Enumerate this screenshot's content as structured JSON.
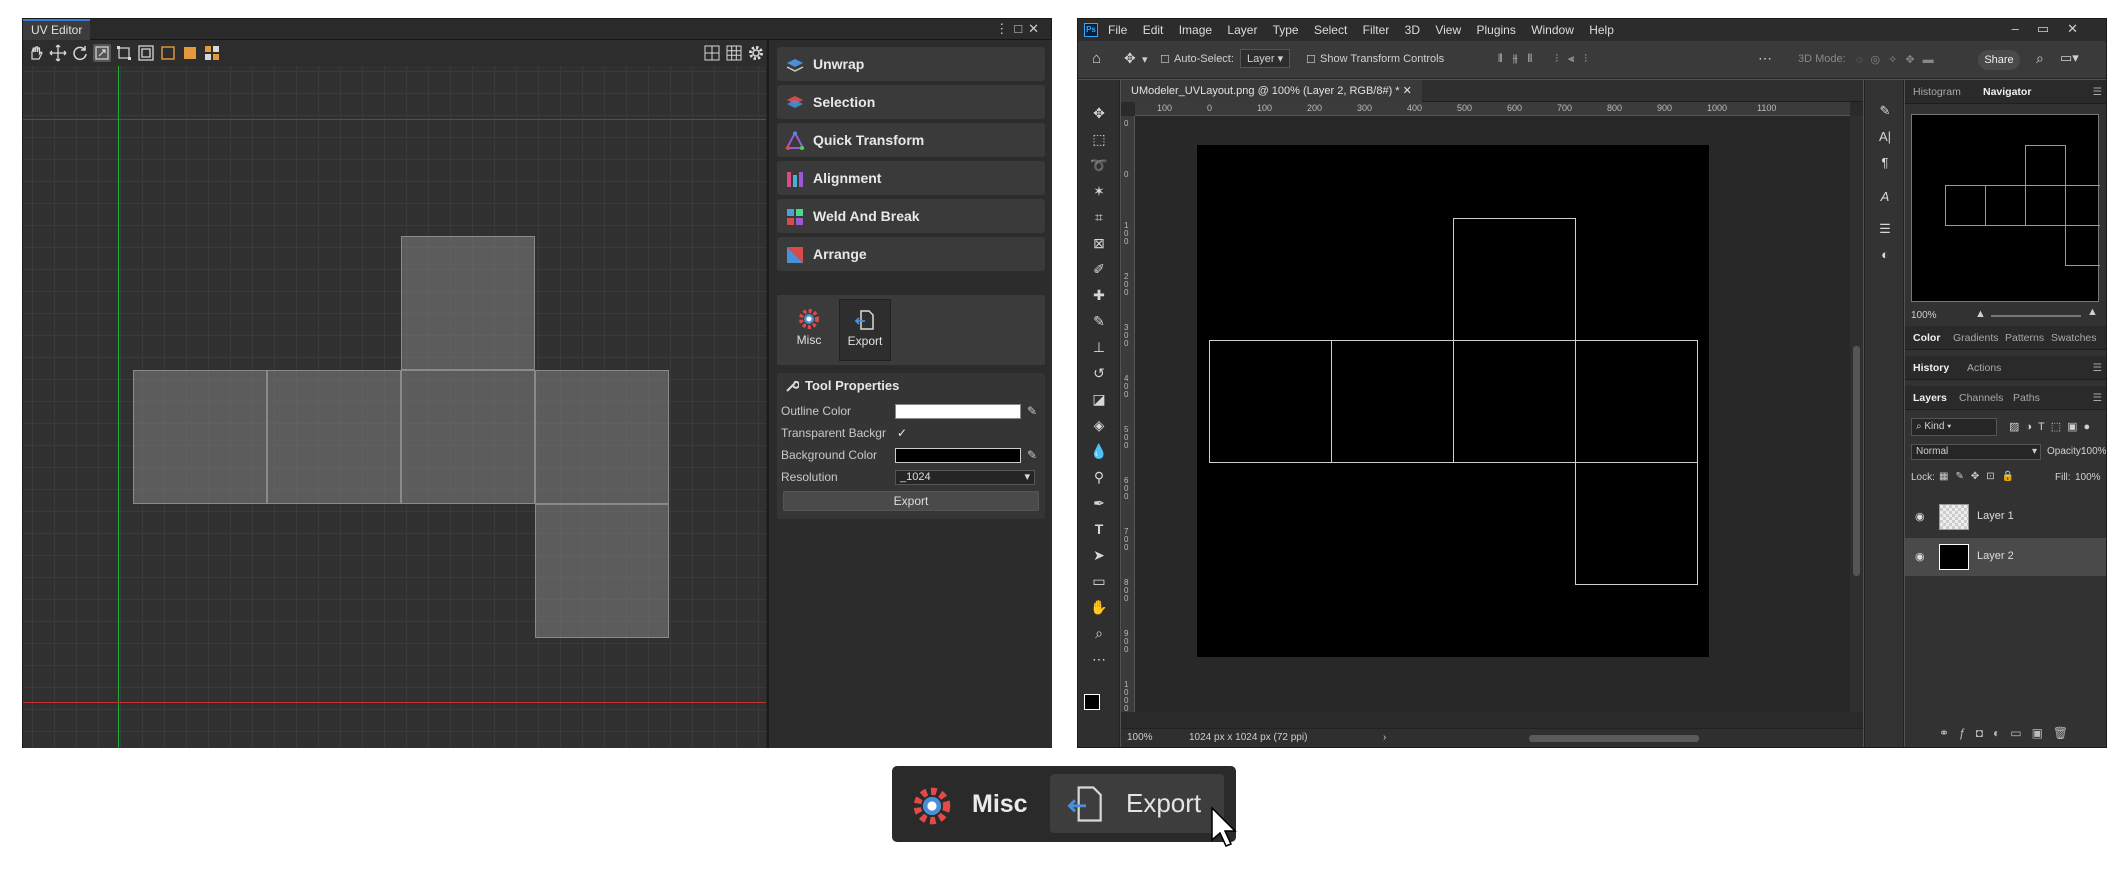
{
  "uv_editor": {
    "title": "UV Editor",
    "menu": [
      {
        "label": "Unwrap",
        "icon": "unwrap-icon"
      },
      {
        "label": "Selection",
        "icon": "selection-icon"
      },
      {
        "label": "Quick Transform",
        "icon": "quick-transform-icon"
      },
      {
        "label": "Alignment",
        "icon": "alignment-icon"
      },
      {
        "label": "Weld And Break",
        "icon": "weld-and-break-icon"
      },
      {
        "label": "Arrange",
        "icon": "arrange-icon"
      }
    ],
    "sub_buttons": [
      {
        "label": "Misc",
        "icon": "misc-gear-icon"
      },
      {
        "label": "Export",
        "icon": "export-icon",
        "selected": true
      }
    ],
    "tool_properties": {
      "title": "Tool Properties",
      "outline_color_label": "Outline Color",
      "outline_color": "#ffffff",
      "transparent_bg_label": "Transparent Backgr",
      "transparent_bg_checked": true,
      "background_color_label": "Background Color",
      "background_color": "#000000",
      "resolution_label": "Resolution",
      "resolution_value": "_1024",
      "export_button": "Export"
    }
  },
  "photoshop": {
    "app_icon": "Ps",
    "menus": [
      "File",
      "Edit",
      "Image",
      "Layer",
      "Type",
      "Select",
      "Filter",
      "3D",
      "View",
      "Plugins",
      "Window",
      "Help"
    ],
    "options": {
      "auto_select_label": "Auto-Select:",
      "auto_select_target": "Layer",
      "show_transform_label": "Show Transform Controls",
      "mode_3d_label": "3D Mode:",
      "share_label": "Share"
    },
    "document_tab": "UModeler_UVLayout.png @ 100% (Layer 2, RGB/8#) *",
    "ruler_h_ticks": [
      "100",
      "0",
      "100",
      "200",
      "300",
      "400",
      "500",
      "600",
      "700",
      "800",
      "900",
      "1000",
      "1100"
    ],
    "ruler_v_ticks": [
      "0",
      "0",
      "1\n0\n0",
      "2\n0\n0",
      "3\n0\n0",
      "4\n0\n0",
      "5\n0\n0",
      "6\n0\n0",
      "7\n0\n0",
      "8\n0\n0",
      "9\n0\n0",
      "1\n0\n0\n0"
    ],
    "status_zoom": "100%",
    "status_info": "1024 px x 1024 px (72 ppi)",
    "panel_tabs_top": [
      "Histogram",
      "Navigator"
    ],
    "navigator_zoom": "100%",
    "panel_tabs_color": [
      "Color",
      "Gradients",
      "Patterns",
      "Swatches"
    ],
    "panel_tabs_history": [
      "History",
      "Actions"
    ],
    "panel_tabs_layers": [
      "Layers",
      "Channels",
      "Paths"
    ],
    "kind_label": "Kind",
    "blend_mode": "Normal",
    "opacity_label": "Opacity:",
    "opacity_value": "100%",
    "lock_label": "Lock:",
    "fill_label": "Fill:",
    "fill_value": "100%",
    "layers": [
      {
        "name": "Layer 1",
        "selected": false
      },
      {
        "name": "Layer 2",
        "selected": true
      }
    ]
  },
  "callout": {
    "misc_label": "Misc",
    "export_label": "Export"
  }
}
